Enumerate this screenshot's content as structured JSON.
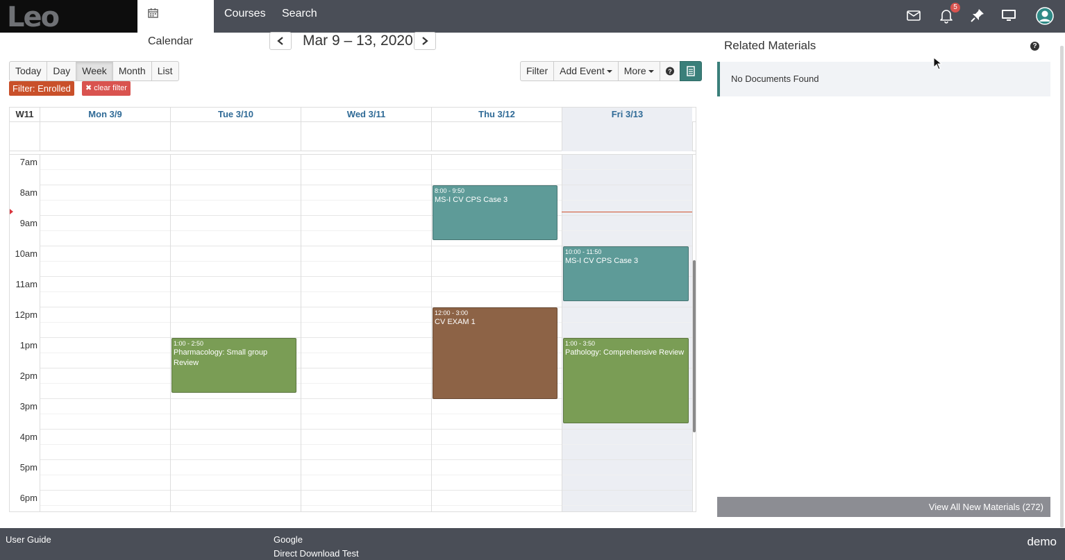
{
  "app": {
    "logo_text": "Leo"
  },
  "topnav": {
    "tabs": [
      {
        "label": "Calendar",
        "icon": "calendar-icon",
        "active": true
      },
      {
        "label": "Courses"
      },
      {
        "label": "Search"
      }
    ],
    "icons": [
      "mail-icon",
      "bell-icon",
      "pin-icon",
      "monitor-icon",
      "user-avatar-icon"
    ],
    "notification_count": "5"
  },
  "calendar": {
    "range_title": "Mar 9 – 13, 2020",
    "view_buttons": [
      "Today",
      "Day",
      "Week",
      "Month",
      "List"
    ],
    "active_view": "Week",
    "action_buttons": {
      "filter": "Filter",
      "add_event": "Add Event",
      "more": "More"
    },
    "filter_label": "Filter: Enrolled",
    "clear_filter": "clear filter",
    "week_label": "W11",
    "days": [
      "Mon 3/9",
      "Tue 3/10",
      "Wed 3/11",
      "Thu 3/12",
      "Fri 3/13"
    ],
    "time_labels": [
      "7am",
      "8am",
      "9am",
      "10am",
      "11am",
      "12pm",
      "1pm",
      "2pm",
      "3pm",
      "4pm",
      "5pm",
      "6pm"
    ],
    "events": [
      {
        "day": "Thu 3/12",
        "time": "8:00 - 9:50",
        "title": "MS-I CV CPS Case 3",
        "color": "#5e9b98"
      },
      {
        "day": "Fri 3/13",
        "time": "10:00 - 11:50",
        "title": "MS-I CV CPS Case 3",
        "color": "#5e9b98"
      },
      {
        "day": "Thu 3/12",
        "time": "12:00 - 3:00",
        "title": "CV EXAM 1",
        "color": "#8d6346"
      },
      {
        "day": "Tue 3/10",
        "time": "1:00 - 2:50",
        "title": "Pharmacology: Small group Review",
        "color": "#7a9d55"
      },
      {
        "day": "Fri 3/13",
        "time": "1:00 - 3:50",
        "title": "Pathology: Comprehensive Review",
        "color": "#7a9d55"
      }
    ]
  },
  "related_materials": {
    "title": "Related Materials",
    "empty_text": "No Documents Found",
    "view_all": "View All New Materials (272)"
  },
  "footer": {
    "links": [
      "User Guide",
      "Google",
      "Direct Download Test"
    ],
    "brand": "demo"
  },
  "colors": {
    "nav_bg": "#4a4e57",
    "accent_teal": "#3a7f7a",
    "filter_orange": "#c9502a",
    "clear_red": "#d9534f"
  }
}
